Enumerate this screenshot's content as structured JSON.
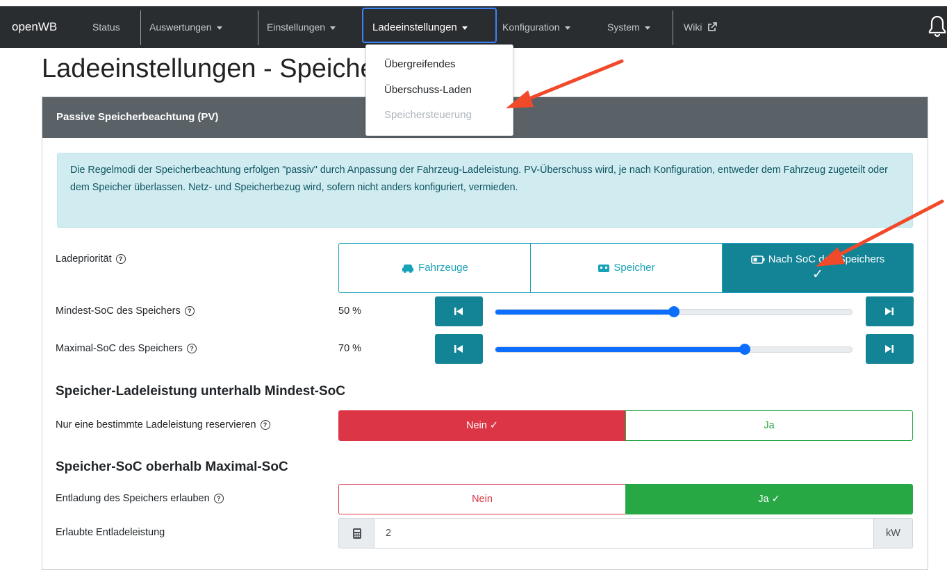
{
  "colors": {
    "navbar": "#2a2d30",
    "accent": "#17a2b8",
    "danger": "#dc3545",
    "success": "#28a745",
    "slider": "#0d6efd",
    "annotation_arrow": "#f04a2a"
  },
  "navbar": {
    "brand": "openWB",
    "items": [
      {
        "label": "Status"
      },
      {
        "label": "Auswertungen"
      },
      {
        "label": "Einstellungen"
      },
      {
        "label": "Ladeeinstellungen",
        "active": true
      },
      {
        "label": "Konfiguration"
      },
      {
        "label": "System"
      },
      {
        "label": "Wiki"
      }
    ],
    "bell_icon": "bell-icon"
  },
  "dropdown": {
    "items": [
      {
        "label": "Übergreifendes"
      },
      {
        "label": "Überschuss-Laden"
      },
      {
        "label": "Speichersteuerung",
        "disabled": true
      }
    ]
  },
  "page": {
    "title": "Ladeeinstellungen - Speichersteuerung"
  },
  "card": {
    "header": "Passive Speicherbeachtung (PV)",
    "info": "Die Regelmodi der Speicherbeachtung erfolgen \"passiv\" durch Anpassung der Fahrzeug-Ladeleistung. PV-Überschuss wird, je nach Konfiguration, entweder dem Fahrzeug zugeteilt oder dem Speicher überlassen. Netz- und Speicherbezug wird, sofern nicht anders konfiguriert, vermieden."
  },
  "priority": {
    "label": "Ladepriorität",
    "options": [
      {
        "label": "Fahrzeuge",
        "icon": "car-icon"
      },
      {
        "label": "Speicher",
        "icon": "battery-car-icon"
      },
      {
        "label": "Nach SoC des Speichers",
        "icon": "battery-icon",
        "selected": true,
        "check": "✓"
      }
    ]
  },
  "min_soc": {
    "label": "Mindest-SoC des Speichers",
    "value_text": "50 %",
    "value": 50
  },
  "max_soc": {
    "label": "Maximal-SoC des Speichers",
    "value_text": "70 %",
    "value": 70
  },
  "section1": {
    "heading": "Speicher-Ladeleistung unterhalb Mindest-SoC",
    "label": "Nur eine bestimmte Ladeleistung reservieren",
    "no": "Nein ✓",
    "yes": "Ja"
  },
  "section2": {
    "heading": "Speicher-SoC oberhalb Maximal-SoC",
    "label": "Entladung des Speichers erlauben",
    "no": "Nein",
    "yes": "Ja ✓"
  },
  "discharge": {
    "label": "Erlaubte Entladeleistung",
    "value": "2",
    "unit": "kW"
  }
}
